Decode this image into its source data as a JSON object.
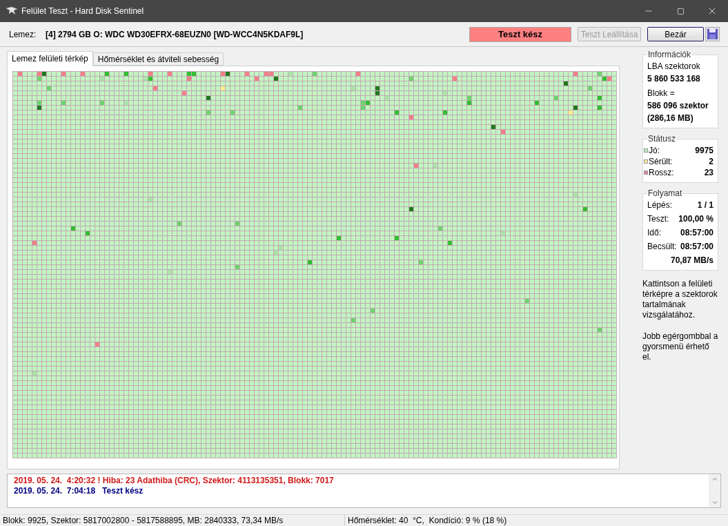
{
  "window": {
    "title": "Felület Teszt - Hard Disk Sentinel"
  },
  "disk": {
    "label": "Lemez:",
    "value": "[4] 2794 GB O: WDC WD30EFRX-68EUZN0 [WD-WCC4N5KDAF9L]"
  },
  "status_banner": "Teszt kész",
  "buttons": [
    {
      "label": "Teszt Leállítása",
      "disabled": true,
      "default": false
    },
    {
      "label": "Bezár",
      "disabled": false,
      "default": true
    }
  ],
  "tabs": [
    {
      "label": "Lemez felületi térkép",
      "selected": true
    },
    {
      "label": "Hőmérséklet és átviteli sebesség",
      "selected": false
    }
  ],
  "info": {
    "title": "Információk",
    "lines": [
      {
        "text": "LBA szektorok",
        "kind": "label"
      },
      {
        "text": "5 860 533 168",
        "kind": "value"
      },
      {
        "text": "Blokk =",
        "kind": "label"
      },
      {
        "text": "586 096 szektor",
        "kind": "value"
      },
      {
        "text": "(286,16 MB)",
        "kind": "value"
      }
    ]
  },
  "status": {
    "title": "Státusz",
    "items": [
      {
        "label": "Jó:",
        "value": "9975",
        "color": "#b8ecb8"
      },
      {
        "label": "Sérült:",
        "value": "2",
        "color": "#f4eca0"
      },
      {
        "label": "Rossz:",
        "value": "23",
        "color": "#d88898"
      }
    ]
  },
  "progress": {
    "title": "Folyamat",
    "rows": [
      {
        "label": "Lépés:",
        "value": "1 / 1"
      },
      {
        "label": "Teszt:",
        "value": "100,00 %"
      },
      {
        "label": "Idő:",
        "value": "08:57:00"
      },
      {
        "label": "Becsült:",
        "value": "08:57:00"
      },
      {
        "value": "70,87 MB/s"
      }
    ]
  },
  "hints": [
    "Kattintson a felületi térképre a szektorok tartalmának vizsgálatához.",
    "Jobb egérgombbal a gyorsmenü érhető el."
  ],
  "log": [
    {
      "text": "2019. 05. 24.  4:20:32 ! Hiba: 23 Adathiba (CRC), Szektor: 4113135351, Blokk: 7017",
      "kind": "error"
    },
    {
      "text": "2019. 05. 24.  7:04:18   Teszt kész",
      "kind": "info"
    }
  ],
  "status_bar": [
    "Blokk: 9925, Szektor: 5817002800 - 5817588895, MB: 2840333, 73,34 MB/s",
    "Hőmérséklet: 40  °C,  Kondíció: 9 % (18 %)"
  ]
}
